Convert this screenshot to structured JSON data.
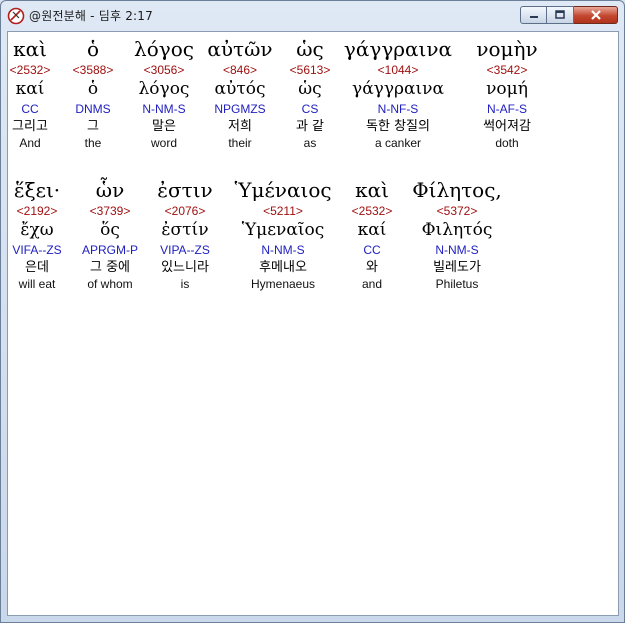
{
  "window": {
    "title": "@원전분해 - 딤후 2:17"
  },
  "icons": {
    "app": "app-logo-icon",
    "minimize": "minimize-icon",
    "maximize": "maximize-icon",
    "close": "close-icon"
  },
  "colors": {
    "strong_number": "#a01010",
    "parsing_code": "#2020c0",
    "close_button": "#c4472f"
  },
  "words": [
    {
      "greek": "καὶ",
      "strong": "<2532>",
      "lemma": "καί",
      "parse": "CC",
      "korean": "그리고",
      "english": "And"
    },
    {
      "greek": "ὁ",
      "strong": "<3588>",
      "lemma": "ὁ",
      "parse": "DNMS",
      "korean": "그",
      "english": "the"
    },
    {
      "greek": "λόγος",
      "strong": "<3056>",
      "lemma": "λόγος",
      "parse": "N-NM-S",
      "korean": "말은",
      "english": "word"
    },
    {
      "greek": "αὐτῶν",
      "strong": "<846>",
      "lemma": "αὐτός",
      "parse": "NPGMZS",
      "korean": "저희",
      "english": "their"
    },
    {
      "greek": "ὡς",
      "strong": "<5613>",
      "lemma": "ὡς",
      "parse": "CS",
      "korean": "과 같",
      "english": "as"
    },
    {
      "greek": "γάγγραινα",
      "strong": "<1044>",
      "lemma": "γάγγραινα",
      "parse": "N-NF-S",
      "korean": "독한 창질의",
      "english": "a canker"
    },
    {
      "greek": "νομὴν",
      "strong": "<3542>",
      "lemma": "νομή",
      "parse": "N-AF-S",
      "korean": "썩어져감",
      "english": "doth"
    },
    {
      "greek": "ἕξει·",
      "strong": "<2192>",
      "lemma": "ἔχω",
      "parse": "VIFA--ZS",
      "korean": "은데",
      "english": "will eat"
    },
    {
      "greek": "ὧν",
      "strong": "<3739>",
      "lemma": "ὅς",
      "parse": "APRGM-P",
      "korean": "그 중에",
      "english": "of whom"
    },
    {
      "greek": "ἐστιν",
      "strong": "<2076>",
      "lemma": "ἐστίν",
      "parse": "VIPA--ZS",
      "korean": "있느니라",
      "english": "is"
    },
    {
      "greek": "Ὑμέναιος",
      "strong": "<5211>",
      "lemma": "Ὑμεναῖος",
      "parse": "N-NM-S",
      "korean": "후메내오",
      "english": "Hymenaeus"
    },
    {
      "greek": "καὶ",
      "strong": "<2532>",
      "lemma": "καί",
      "parse": "CC",
      "korean": "와",
      "english": "and"
    },
    {
      "greek": "Φίλητος,",
      "strong": "<5372>",
      "lemma": "Φιλητός",
      "parse": "N-NM-S",
      "korean": "빌레도가",
      "english": "Philetus"
    }
  ]
}
